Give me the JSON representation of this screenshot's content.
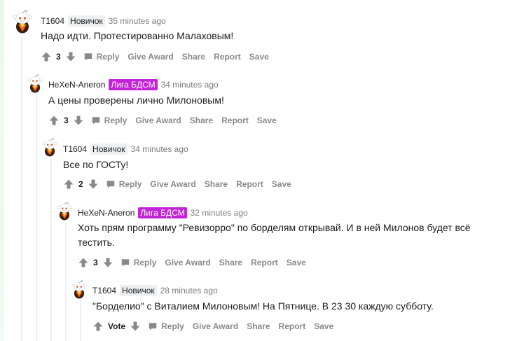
{
  "comments": [
    {
      "author": "T1604",
      "flair": "Новичок",
      "flair_color": "#edeff1",
      "time": "35 minutes ago",
      "text": "Надо идти. Протестированно Малаховым!",
      "score": "3",
      "actions": {
        "reply": "Reply",
        "give_award": "Give Award",
        "share": "Share",
        "report": "Report",
        "save": "Save"
      }
    },
    {
      "author": "HeXeN-Aneron",
      "flair": "Лига БДСМ",
      "flair_color": "#c224d8",
      "time": "34 minutes ago",
      "text": "А цены проверены лично Милоновым!",
      "score": "3",
      "actions": {
        "reply": "Reply",
        "give_award": "Give Award",
        "share": "Share",
        "report": "Report",
        "save": "Save"
      }
    },
    {
      "author": "T1604",
      "flair": "Новичок",
      "flair_color": "#edeff1",
      "time": "34 minutes ago",
      "text": "Все по ГОСТу!",
      "score": "2",
      "actions": {
        "reply": "Reply",
        "give_award": "Give Award",
        "share": "Share",
        "report": "Report",
        "save": "Save"
      }
    },
    {
      "author": "HeXeN-Aneron",
      "flair": "Лига БДСМ",
      "flair_color": "#c224d8",
      "time": "32 minutes ago",
      "text": "Хоть прям программу \"Ревизорро\" по борделям открывай. И в ней Милонов будет всё тестить.",
      "score": "3",
      "actions": {
        "reply": "Reply",
        "give_award": "Give Award",
        "share": "Share",
        "report": "Report",
        "save": "Save"
      }
    },
    {
      "author": "T1604",
      "flair": "Новичок",
      "flair_color": "#edeff1",
      "time": "28 minutes ago",
      "text": "\"Борделио\" с Виталием Милоновым! На Пятнице. В 23 30 каждую субботу.",
      "score": "Vote",
      "actions": {
        "reply": "Reply",
        "give_award": "Give Award",
        "share": "Share",
        "report": "Report",
        "save": "Save"
      }
    }
  ],
  "icons": {
    "upvote": "upvote-icon",
    "downvote": "downvote-icon",
    "reply": "comment-bubble-icon",
    "avatar": "snoo-avatar-icon"
  },
  "colors": {
    "meta_gray": "#878a8c",
    "thread_line": "#edeff1",
    "flair_purple": "#c224d8"
  }
}
